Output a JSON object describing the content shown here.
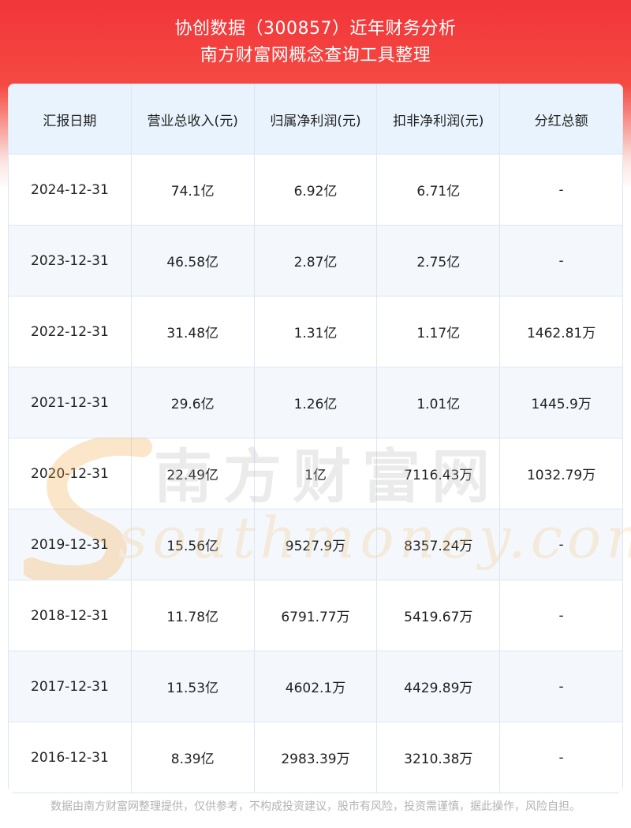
{
  "header": {
    "title_line1": "协创数据（300857）近年财务分析",
    "title_line2": "南方财富网概念查询工具整理"
  },
  "table": {
    "columns": [
      "汇报日期",
      "营业总收入(元)",
      "归属净利润(元)",
      "扣非净利润(元)",
      "分红总额"
    ],
    "rows": [
      [
        "2024-12-31",
        "74.1亿",
        "6.92亿",
        "6.71亿",
        "-"
      ],
      [
        "2023-12-31",
        "46.58亿",
        "2.87亿",
        "2.75亿",
        "-"
      ],
      [
        "2022-12-31",
        "31.48亿",
        "1.31亿",
        "1.17亿",
        "1462.81万"
      ],
      [
        "2021-12-31",
        "29.6亿",
        "1.26亿",
        "1.01亿",
        "1445.9万"
      ],
      [
        "2020-12-31",
        "22.49亿",
        "1亿",
        "7116.43万",
        "1032.79万"
      ],
      [
        "2019-12-31",
        "15.56亿",
        "9527.9万",
        "8357.24万",
        "-"
      ],
      [
        "2018-12-31",
        "11.78亿",
        "6791.77万",
        "5419.67万",
        "-"
      ],
      [
        "2017-12-31",
        "11.53亿",
        "4602.1万",
        "4429.89万",
        "-"
      ],
      [
        "2016-12-31",
        "8.39亿",
        "2983.39万",
        "3210.38万",
        "-"
      ]
    ]
  },
  "watermark": {
    "cn": "南方财富网",
    "en": "southmoney.com"
  },
  "footer": {
    "disclaimer": "数据由南方财富网整理提供，仅供参考，不构成投资建议，股市有风险，投资需谨慎，据此操作，风险自担。"
  },
  "colors": {
    "header_red": "#f2353a",
    "table_header_bg": "#e9f3fd",
    "grid_line": "#dbe6f3",
    "watermark_orange": "#f6c88a"
  }
}
